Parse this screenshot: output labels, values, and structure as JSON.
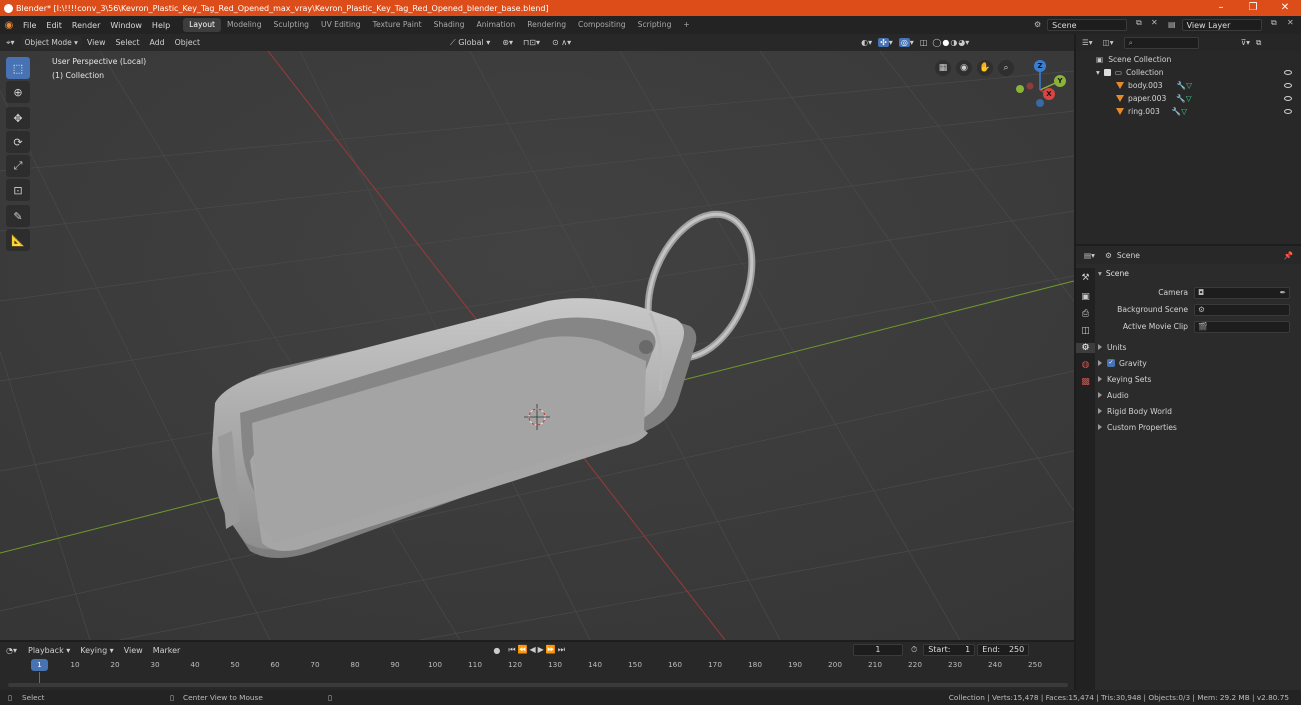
{
  "window": {
    "title": "Blender* [I:\\!!!!conv_3\\56\\Kevron_Plastic_Key_Tag_Red_Opened_max_vray\\Kevron_Plastic_Key_Tag_Red_Opened_blender_base.blend]",
    "minimize": "–",
    "restore": "❐",
    "close": "✕"
  },
  "menu": {
    "items": [
      "File",
      "Edit",
      "Render",
      "Window",
      "Help"
    ],
    "workspaces": [
      "Layout",
      "Modeling",
      "Sculpting",
      "UV Editing",
      "Texture Paint",
      "Shading",
      "Animation",
      "Rendering",
      "Compositing",
      "Scripting"
    ],
    "add_workspace": "+",
    "scene_label": "Scene",
    "view_layer_label": "View Layer"
  },
  "viewport_header": {
    "mode": "Object Mode",
    "menus": [
      "View",
      "Select",
      "Add",
      "Object"
    ],
    "orientation": "Global"
  },
  "viewport": {
    "perspective_label": "User Perspective (Local)",
    "collection_label": "(1) Collection",
    "gizmo_axes": {
      "x": "X",
      "y": "Y",
      "z": "Z"
    }
  },
  "outliner": {
    "root": "Scene Collection",
    "collection": "Collection",
    "objects": [
      "body.003",
      "paper.003",
      "ring.003"
    ]
  },
  "properties": {
    "header_title": "Scene",
    "panel_title": "Scene",
    "fields": {
      "camera": "Camera",
      "background_scene": "Background Scene",
      "active_movie_clip": "Active Movie Clip"
    },
    "sections": [
      "Units",
      "Gravity",
      "Keying Sets",
      "Audio",
      "Rigid Body World",
      "Custom Properties"
    ],
    "gravity_checked": true
  },
  "timeline": {
    "menus": [
      "Playback",
      "Keying",
      "View",
      "Marker"
    ],
    "current_frame": "1",
    "start_label": "Start:",
    "start": "1",
    "end_label": "End:",
    "end": "250",
    "ticks": [
      "10",
      "20",
      "30",
      "40",
      "50",
      "60",
      "70",
      "80",
      "90",
      "100",
      "110",
      "120",
      "130",
      "140",
      "150",
      "160",
      "170",
      "180",
      "190",
      "200",
      "210",
      "220",
      "230",
      "240",
      "250"
    ],
    "playhead_label": "1"
  },
  "statusbar": {
    "select": "Select",
    "center_view": "Center View to Mouse",
    "stats": "Collection | Verts:15,478 | Faces:15,474 | Tris:30,948 | Objects:0/3 | Mem: 29.2 MB | v2.80.75"
  },
  "colors": {
    "title_bar": "#dd4d1a",
    "accent_blue": "#4772b3",
    "viewport_bg": "#3d3d3d",
    "axis_x": "#c43c3c",
    "axis_y": "#6e9a2e",
    "object_orange": "#e58a2c"
  }
}
